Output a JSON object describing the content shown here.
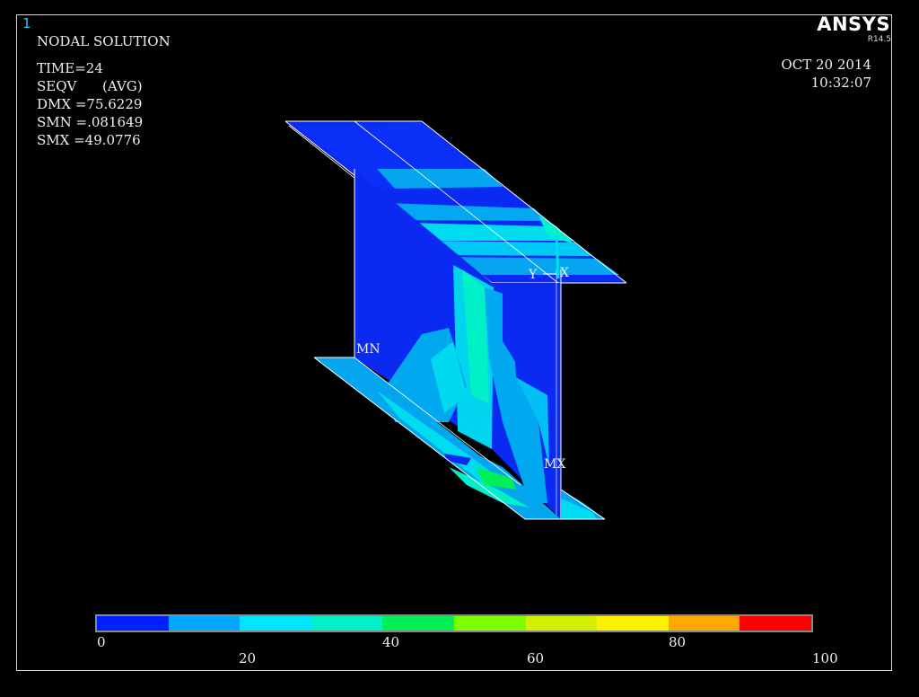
{
  "window_number": "1",
  "brand": {
    "name": "ANSYS",
    "version": "R14.5"
  },
  "timestamp": {
    "date": "OCT 20 2014",
    "time": "10:32:07"
  },
  "info": {
    "title": "NODAL SOLUTION",
    "time": "TIME=24",
    "quantity": "SEQV      (AVG)",
    "dmx": "DMX =75.6229",
    "smn": "SMN =.081649",
    "smx": "SMX =49.0776"
  },
  "markers": {
    "min": "MN",
    "max": "MX",
    "axis_y": "Y",
    "axis_x": "X"
  },
  "legend": {
    "colors": [
      "#0020ff",
      "#00a6ff",
      "#00e5ff",
      "#00f0c8",
      "#00ee56",
      "#7cff00",
      "#d4f000",
      "#fff000",
      "#ffa800",
      "#ff0000"
    ],
    "labels_top": [
      "0",
      "40",
      "80"
    ],
    "labels_bottom": [
      "20",
      "60",
      "100"
    ]
  },
  "colors": {
    "background": "#000000",
    "accent": "#35c2ff"
  }
}
